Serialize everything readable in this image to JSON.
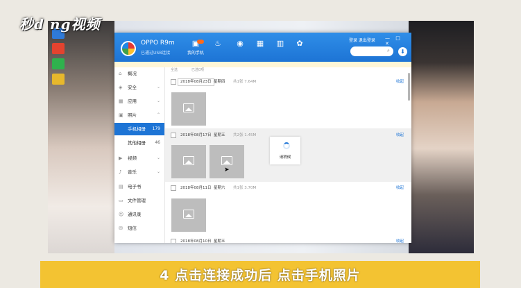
{
  "logo": {
    "text": "秒d ng视频"
  },
  "caption": "4 点击连接成功后 点击手机照片",
  "app": {
    "device_name": "OPPO R9m",
    "device_status": "已通过USB连接",
    "top_links": "登录 退出登录",
    "window_controls": "— □ ✕",
    "badge": "",
    "nav": [
      {
        "label": "我的手机",
        "icon": "phone-icon"
      },
      {
        "label": "",
        "icon": "fire-icon"
      },
      {
        "label": "",
        "icon": "apps-icon"
      },
      {
        "label": "",
        "icon": "chart-icon"
      },
      {
        "label": "",
        "icon": "bar-icon"
      },
      {
        "label": "",
        "icon": "tools-icon"
      }
    ],
    "notice": "",
    "sidebar": [
      {
        "label": "概况",
        "count": ""
      },
      {
        "label": "安全",
        "count": ""
      },
      {
        "label": "应用",
        "count": ""
      },
      {
        "label": "照片",
        "count": ""
      },
      {
        "label": "手机相册",
        "count": "179"
      },
      {
        "label": "其他相册",
        "count": "46"
      },
      {
        "label": "视频",
        "count": ""
      },
      {
        "label": "音乐",
        "count": ""
      },
      {
        "label": "电子书",
        "count": ""
      },
      {
        "label": "文件管理",
        "count": ""
      },
      {
        "label": "通讯录",
        "count": ""
      },
      {
        "label": "短信",
        "count": ""
      }
    ],
    "toolbar": {
      "select_all": "全选",
      "selected": "已选0项"
    },
    "sections": [
      {
        "date": "2018年08月23日",
        "weekday": "星期四",
        "meta": "共1张  7.64M",
        "collapse": "收起"
      },
      {
        "date": "2018年08月17日",
        "weekday": "星期五",
        "meta": "共2张  1.45M",
        "collapse": "收起"
      },
      {
        "date": "2018年08月11日",
        "weekday": "星期六",
        "meta": "共1张  3.70M",
        "collapse": "收起"
      },
      {
        "date": "2018年08月10日",
        "weekday": "星期五",
        "meta": "",
        "collapse": "收起"
      }
    ],
    "loading_text": "请稍候"
  }
}
